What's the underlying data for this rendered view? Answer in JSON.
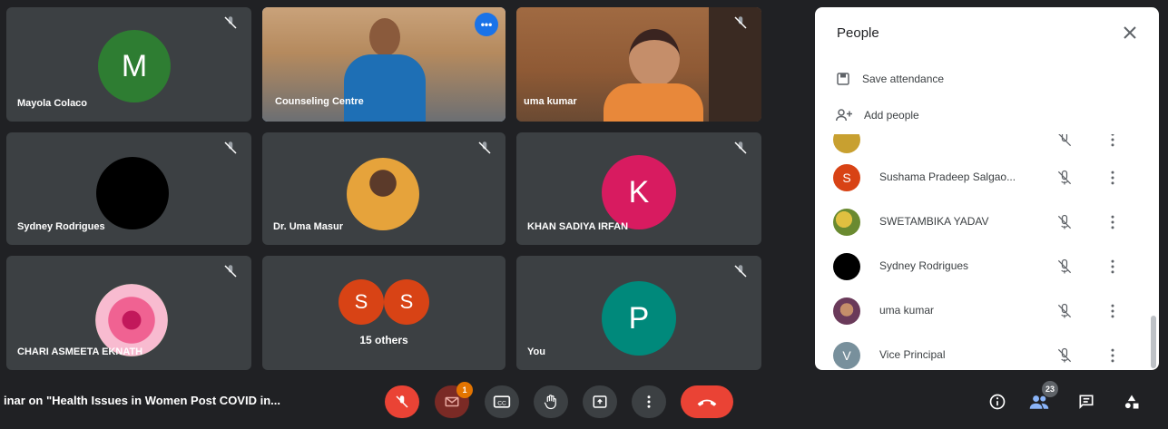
{
  "tiles": [
    {
      "name": "Mayola Colaco",
      "initial": "M",
      "color": "#2e7d32",
      "type": "initial"
    },
    {
      "name": "Counseling Centre",
      "type": "video-blue"
    },
    {
      "name": "uma kumar",
      "type": "video-room"
    },
    {
      "name": "Sydney Rodrigues",
      "type": "black-avatar"
    },
    {
      "name": "Dr. Uma Masur",
      "type": "photo-avatar"
    },
    {
      "name": "KHAN SADIYA IRFAN",
      "initial": "K",
      "color": "#d81b60",
      "type": "initial"
    },
    {
      "name": "CHARI ASMEETA EKNATH",
      "type": "rose-avatar"
    },
    {
      "name": "15 others",
      "initials": [
        "S",
        "S"
      ],
      "color": "#d84315",
      "type": "others"
    },
    {
      "name": "You",
      "initial": "P",
      "color": "#00897b",
      "type": "initial"
    }
  ],
  "panel": {
    "title": "People",
    "save_attendance": "Save attendance",
    "add_people": "Add people",
    "participants": [
      {
        "name": "Sushama Pradeep Salgao...",
        "initial": "S",
        "color": "#d84315",
        "kind": "initial"
      },
      {
        "name": "SWETAMBIKA YADAV",
        "kind": "photo-yellow"
      },
      {
        "name": "Sydney Rodrigues",
        "kind": "black"
      },
      {
        "name": "uma kumar",
        "kind": "photo-face"
      },
      {
        "name": "Vice Principal",
        "initial": "V",
        "color": "#78909c",
        "kind": "initial"
      }
    ]
  },
  "bottombar": {
    "meeting_title": "inar on \"Health Issues in Women Post COVID in...",
    "chat_badge": "1",
    "people_count": "23"
  },
  "icons": {
    "mic_off": "mic-off-icon",
    "more": "more-vert-icon",
    "close": "close-icon",
    "hand": "raise-hand-icon",
    "present": "present-icon",
    "captions": "captions-icon",
    "end_call": "end-call-icon"
  },
  "colors": {
    "accent": "#8ab4f8",
    "danger": "#ea4335",
    "tile_bg": "#3c4043",
    "page_bg": "#202124"
  }
}
